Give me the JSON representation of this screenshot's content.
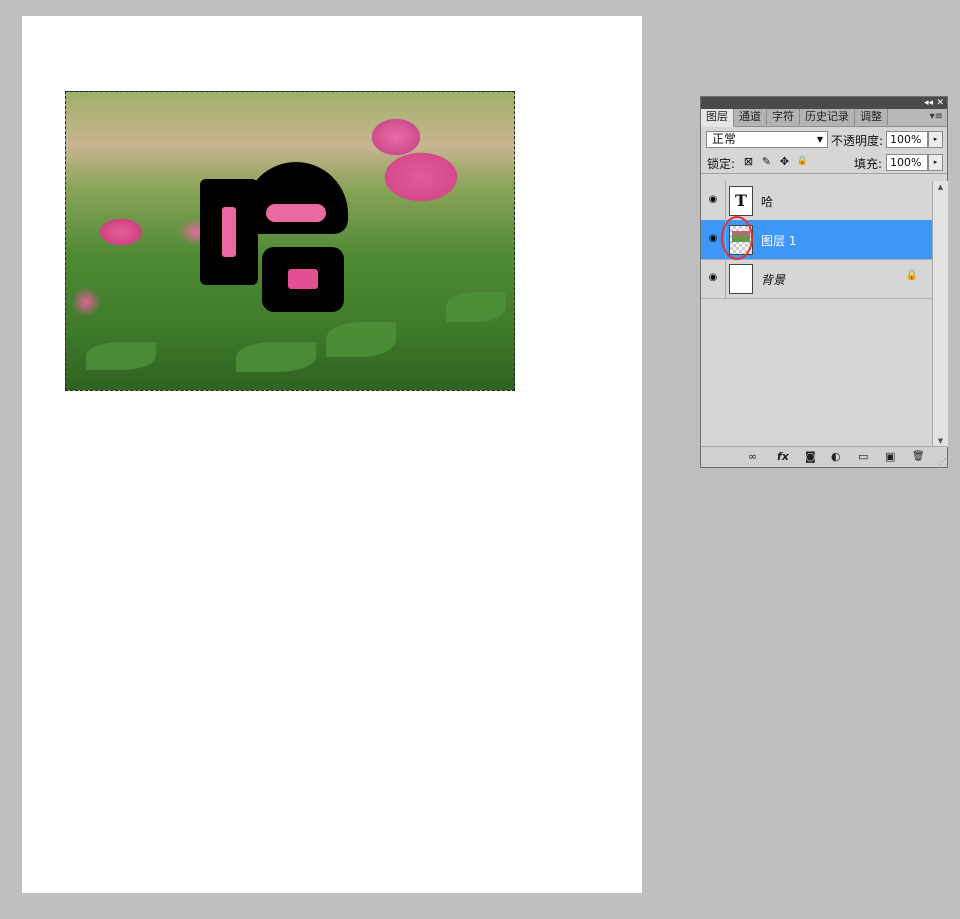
{
  "canvas": {
    "glyph_text": "哈"
  },
  "panel": {
    "tabs": [
      "图层",
      "通道",
      "字符",
      "历史记录",
      "调整"
    ],
    "active_tab": "图层",
    "blend_mode": "正常",
    "opacity_label": "不透明度:",
    "opacity_value": "100%",
    "lock_label": "锁定:",
    "fill_label": "填充:",
    "fill_value": "100%",
    "layers": [
      {
        "name": "哈",
        "type": "text",
        "thumb_glyph": "T",
        "visible": true,
        "selected": false
      },
      {
        "name": "图层 1",
        "type": "pixel",
        "visible": true,
        "selected": true
      },
      {
        "name": "背景",
        "type": "background",
        "visible": true,
        "selected": false,
        "locked": true
      }
    ],
    "icons": {
      "stepper": "▸",
      "lock_transparent": "⊠",
      "lock_paint": "✎",
      "lock_move": "✥",
      "lock_all": "🔒",
      "eye": "◉",
      "link": "∞",
      "fx": "fx",
      "mask": "◙",
      "adjust": "◐",
      "group": "▭",
      "new_layer": "▣",
      "trash": "🗑"
    },
    "colors": {
      "selection": "#3d97f6",
      "highlight_circle": "#e53030"
    }
  }
}
